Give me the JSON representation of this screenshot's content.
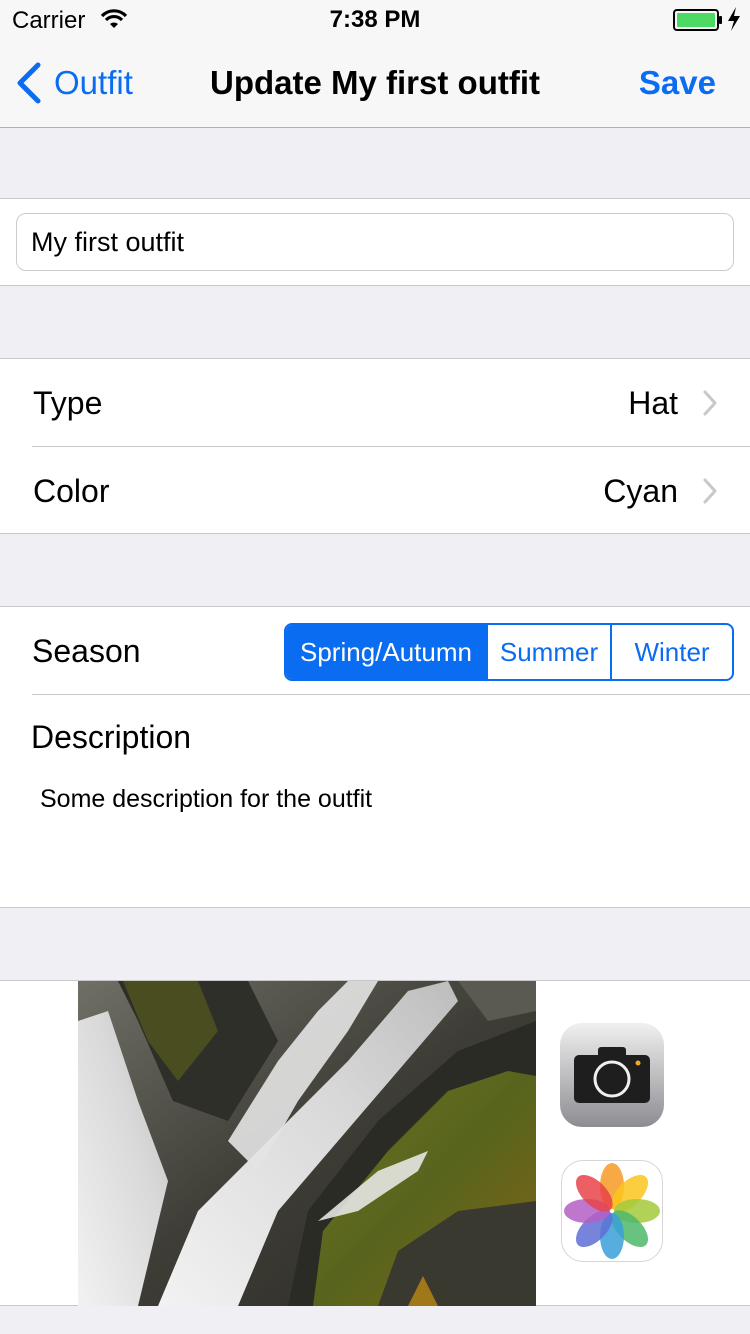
{
  "status_bar": {
    "carrier": "Carrier",
    "time": "7:38 PM",
    "icons": [
      "wifi-icon",
      "battery-icon",
      "charging-bolt-icon"
    ],
    "battery_color": "#4cd964"
  },
  "nav": {
    "back_label": "Outfit",
    "title": "Update My first outfit",
    "save_label": "Save",
    "accent_color": "#0a6cf0"
  },
  "name_field": {
    "value": "My first outfit"
  },
  "details": {
    "type_label": "Type",
    "type_value": "Hat",
    "color_label": "Color",
    "color_value": "Cyan"
  },
  "season": {
    "label": "Season",
    "options": [
      "Spring/Autumn",
      "Summer",
      "Winter"
    ],
    "selected": "Spring/Autumn"
  },
  "description": {
    "label": "Description",
    "text": "Some description for the outfit"
  },
  "photo": {
    "subject": "waterfall-photo",
    "icons": [
      "camera-icon",
      "photos-icon"
    ]
  }
}
